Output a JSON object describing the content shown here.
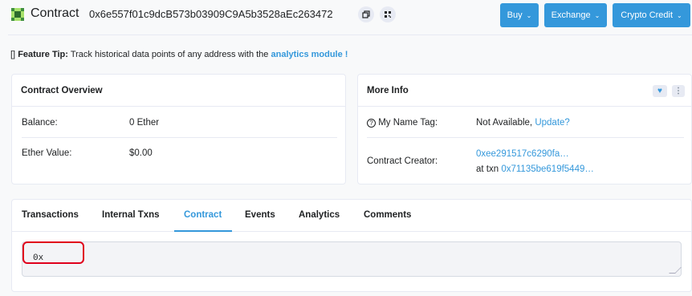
{
  "header": {
    "title": "Contract",
    "address": "0x6e557f01c9dcB573b03909C9A5b3528aEc263472",
    "buttons": [
      {
        "label": "Buy"
      },
      {
        "label": "Exchange"
      },
      {
        "label": "Crypto Credit"
      }
    ]
  },
  "tip": {
    "icon": "[]",
    "label": "Feature Tip:",
    "text": "Track historical data points of any address with the",
    "link": "analytics module !"
  },
  "overview": {
    "title": "Contract Overview",
    "balance_label": "Balance:",
    "balance_value": "0 Ether",
    "ether_value_label": "Ether Value:",
    "ether_value": "$0.00"
  },
  "more_info": {
    "title": "More Info",
    "name_tag_label": "My Name Tag:",
    "name_tag_value": "Not Available,",
    "name_tag_link": "Update?",
    "creator_label": "Contract Creator:",
    "creator_address": "0xee291517c6290fa…",
    "creator_txn_prefix": "at txn",
    "creator_txn": "0x71135be619f5449…"
  },
  "tabs": [
    {
      "label": "Transactions"
    },
    {
      "label": "Internal Txns"
    },
    {
      "label": "Contract"
    },
    {
      "label": "Events"
    },
    {
      "label": "Analytics"
    },
    {
      "label": "Comments"
    }
  ],
  "active_tab": "Contract",
  "code": {
    "value": "0x"
  },
  "colors": {
    "primary": "#3498db",
    "highlight": "#e0001b"
  }
}
